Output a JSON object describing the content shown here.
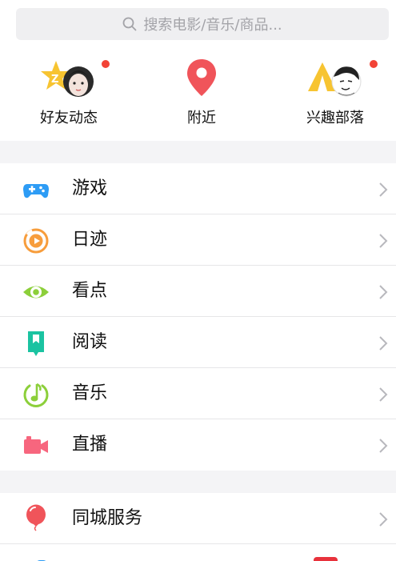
{
  "search": {
    "placeholder": "搜索电影/音乐/商品..."
  },
  "quick_links": [
    {
      "label": "好友动态",
      "icon": "friends-star-icon",
      "badge": true
    },
    {
      "label": "附近",
      "icon": "location-pin-icon",
      "badge": false
    },
    {
      "label": "兴趣部落",
      "icon": "tribe-tent-icon",
      "badge": true
    }
  ],
  "menu_group_1": [
    {
      "label": "游戏",
      "icon": "gamepad-icon",
      "color": "#2d9cf5"
    },
    {
      "label": "日迹",
      "icon": "camera-circle-icon",
      "color": "#f79d3c"
    },
    {
      "label": "看点",
      "icon": "eye-icon",
      "color": "#8ccf3a"
    },
    {
      "label": "阅读",
      "icon": "book-icon",
      "color": "#1bc3a1"
    },
    {
      "label": "音乐",
      "icon": "music-note-icon",
      "color": "#8ccf3a"
    },
    {
      "label": "直播",
      "icon": "video-camera-icon",
      "color": "#f7667e"
    }
  ],
  "menu_group_2": [
    {
      "label": "同城服务",
      "icon": "balloon-icon",
      "color": "#f0545a"
    }
  ],
  "colors": {
    "badge": "#f24336",
    "gap": "#f4f4f6",
    "search_bg": "#efeff1"
  }
}
